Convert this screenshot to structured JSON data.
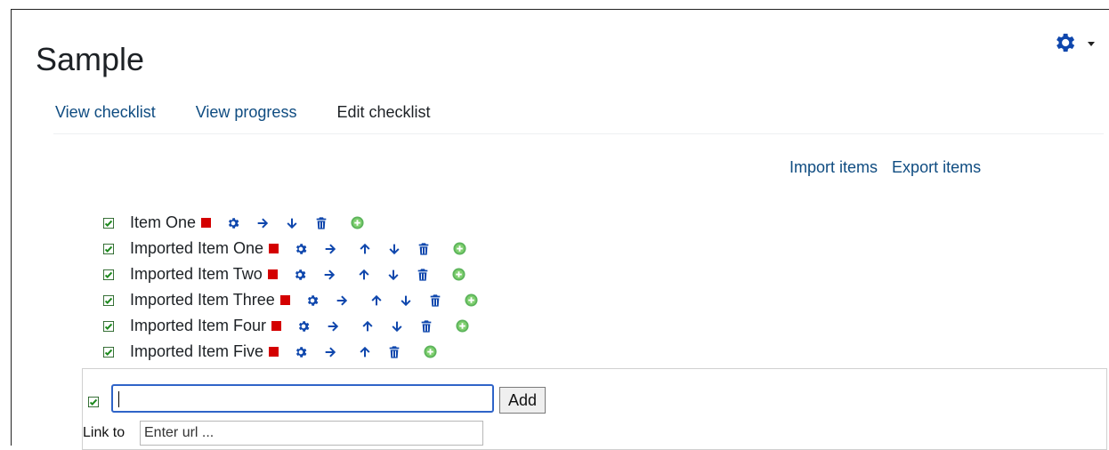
{
  "header": {
    "title": "Sample"
  },
  "tabs": [
    {
      "label": "View checklist"
    },
    {
      "label": "View progress"
    },
    {
      "label": "Edit checklist"
    }
  ],
  "actions": {
    "import": "Import items",
    "export": "Export items"
  },
  "items": [
    {
      "label": "Item One"
    },
    {
      "label": "Imported Item One"
    },
    {
      "label": "Imported Item Two"
    },
    {
      "label": "Imported Item Three"
    },
    {
      "label": "Imported Item Four"
    },
    {
      "label": "Imported Item Five"
    }
  ],
  "add_form": {
    "button_label": "Add",
    "link_label": "Link to",
    "url_placeholder": "Enter url ..."
  },
  "colors": {
    "link": "#0f4c81",
    "icon": "#0f47ad",
    "red_marker": "#d40000",
    "green_add": "#5bb35a"
  }
}
